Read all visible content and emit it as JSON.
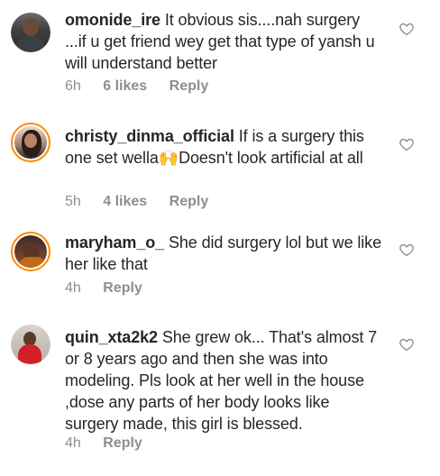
{
  "comments": [
    {
      "username": "omonide_ire",
      "text": "It obvious sis....nah surgery ...if u get friend wey get that type of yansh u will understand better",
      "time": "6h",
      "likes": "6 likes",
      "reply": "Reply"
    },
    {
      "username": "christy_dinma_official",
      "text": "If is a surgery this one set wella🙌Doesn't look artificial at all",
      "time": "5h",
      "likes": "4 likes",
      "reply": "Reply"
    },
    {
      "username": "maryham_o_",
      "text": "She did surgery lol but we like her like that",
      "time": "4h",
      "reply": "Reply"
    },
    {
      "username": "quin_xta2k2",
      "text": "She grew ok... That's almost 7 or 8 years ago and then she was into modeling. Pls look at her well in the house ,dose any parts of her body looks like surgery made, this girl is blessed.",
      "time": "4h",
      "reply": "Reply"
    }
  ],
  "icons": {
    "like": "heart-outline-icon"
  },
  "colors": {
    "story_ring": "#ff8a00",
    "meta": "#8e8e8e",
    "text": "#262626"
  }
}
